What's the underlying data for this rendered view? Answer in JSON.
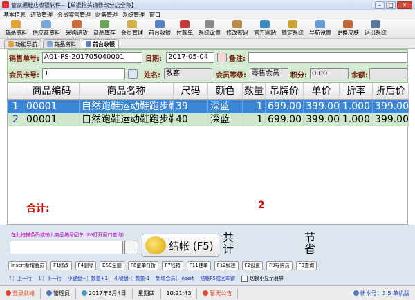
{
  "window": {
    "title": "管家通鞋店收银软件--【单据抬头请修改分店全称】"
  },
  "menu": [
    "基本信息",
    "进货管理",
    "会员零售管理",
    "财务管理",
    "系统管理",
    "窗口"
  ],
  "toolbar": [
    {
      "label": "商品资料",
      "color": "#e2a23a"
    },
    {
      "label": "供应商资料",
      "color": "#7aa6d8"
    },
    {
      "label": "采购进货",
      "color": "#c96b3a"
    },
    {
      "label": "商品库存",
      "color": "#6fa35a"
    },
    {
      "label": "会员管理",
      "color": "#d2b14a"
    },
    {
      "label": "前台收银",
      "color": "#5a7fc2"
    },
    {
      "label": "付款单",
      "color": "#c23a3a"
    },
    {
      "label": "系统设置",
      "color": "#8a8a8a"
    },
    {
      "label": "修改密码",
      "color": "#b88a4a"
    },
    {
      "label": "官方网站",
      "color": "#3a8ac2"
    },
    {
      "label": "锁定系统",
      "color": "#caa23a"
    },
    {
      "label": "导航设置",
      "color": "#6a9ad2"
    },
    {
      "label": "更换皮肤",
      "color": "#c2663a"
    },
    {
      "label": "退出系统",
      "color": "#5a7a9a"
    }
  ],
  "tabs": [
    {
      "label": "功能导航",
      "active": false
    },
    {
      "label": "商品资料",
      "active": false
    },
    {
      "label": "前台收银",
      "active": true
    }
  ],
  "form": {
    "sale_no_label": "销售单号:",
    "sale_no": "A01-PS-201705040001",
    "date_label": "日期:",
    "date": "2017-05-04",
    "note_label": "备注:",
    "note": "",
    "member_card_label": "会员卡号:",
    "member_card": "1",
    "name_label": "姓名:",
    "name": "散客",
    "level_label": "会员等级:",
    "level": "零售会员",
    "points_label": "积分:",
    "points": "0.00",
    "balance_label": "余额:",
    "balance": ""
  },
  "grid": {
    "columns": [
      "",
      "商品编码",
      "商品名称",
      "尺码",
      "颜色",
      "数量",
      "吊牌价",
      "单价",
      "折率",
      "折后价"
    ],
    "rows": [
      [
        "1",
        "00001",
        "自然跑鞋运动鞋跑步鞋",
        "39",
        "深蓝",
        "1",
        "699.00",
        "399.00",
        "1.000",
        "399.00"
      ],
      [
        "2",
        "00001",
        "自然跑鞋运动鞋跑步鞋",
        "40",
        "深蓝",
        "1",
        "699.00",
        "399.00",
        "1.000",
        "399.00"
      ]
    ],
    "total_label": "合计:",
    "total_qty": "2"
  },
  "checkout": {
    "scan_hint": "在此扫描条码或输入商品编号回车 (F6打开窗口查询)",
    "scan_value": "",
    "settle_label": "结帐 (F5)",
    "total_label": "共计",
    "save_label": "节省"
  },
  "shortcuts": [
    "Insert新增会员",
    "F1修改",
    "F4删除",
    "ESC全删",
    "F6整单打折",
    "F7钱箱",
    "F11挂单",
    "F12解挂",
    "F2设置",
    "F9导购员",
    "F3查询"
  ],
  "hints": [
    "↑：上一行",
    "↓：下一行",
    "小键盘+：数量+1",
    "小键盘-：数量-1",
    "新增会员：Insert",
    "结帐F5或回车键",
    "切换小显示器屏"
  ],
  "status": [
    "登录就绪",
    "管理员",
    "2017年5月4日",
    "星期四",
    "10:21:43",
    "暂无公告",
    "新本号：3.5 单机版"
  ]
}
